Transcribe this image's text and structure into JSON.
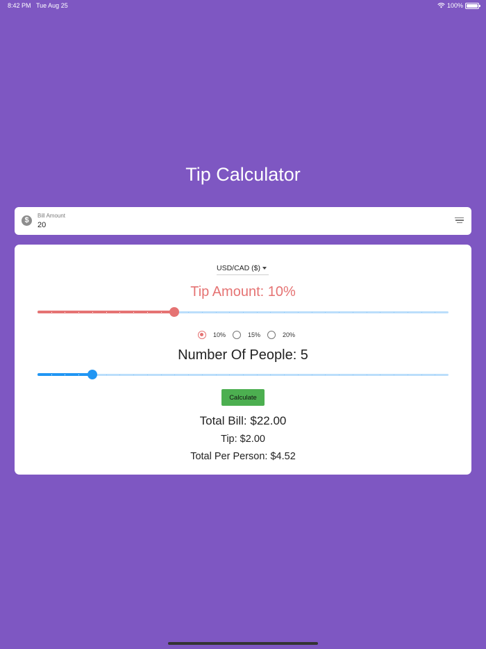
{
  "status_bar": {
    "time": "8:42 PM",
    "date": "Tue Aug 25",
    "battery": "100%",
    "battery_level": 1.0
  },
  "app": {
    "title": "Tip Calculator"
  },
  "bill": {
    "label": "Bill Amount",
    "value": "20",
    "icon": "dollar-icon",
    "trailing_icon": "menu-icon"
  },
  "currency": {
    "selected": "USD/CAD ($)"
  },
  "tip": {
    "title": "Tip Amount: 10%",
    "slider": {
      "min": 0,
      "max": 30,
      "value": 10,
      "divisions": 30
    },
    "options": [
      {
        "label": "10%",
        "selected": true
      },
      {
        "label": "15%",
        "selected": false
      },
      {
        "label": "20%",
        "selected": false
      }
    ]
  },
  "people": {
    "title": "Number Of People: 5",
    "slider": {
      "min": 1,
      "max": 31,
      "value": 5,
      "divisions": 30
    }
  },
  "actions": {
    "calculate_label": "Calculate"
  },
  "results": {
    "total_bill": "Total Bill: $22.00",
    "tip": "Tip: $2.00",
    "per_person": "Total Per Person: $4.52"
  },
  "colors": {
    "background": "#7e57c2",
    "tip_accent": "#e57373",
    "people_accent": "#2196f3",
    "track": "#bbdefb",
    "button": "#4caf50"
  }
}
